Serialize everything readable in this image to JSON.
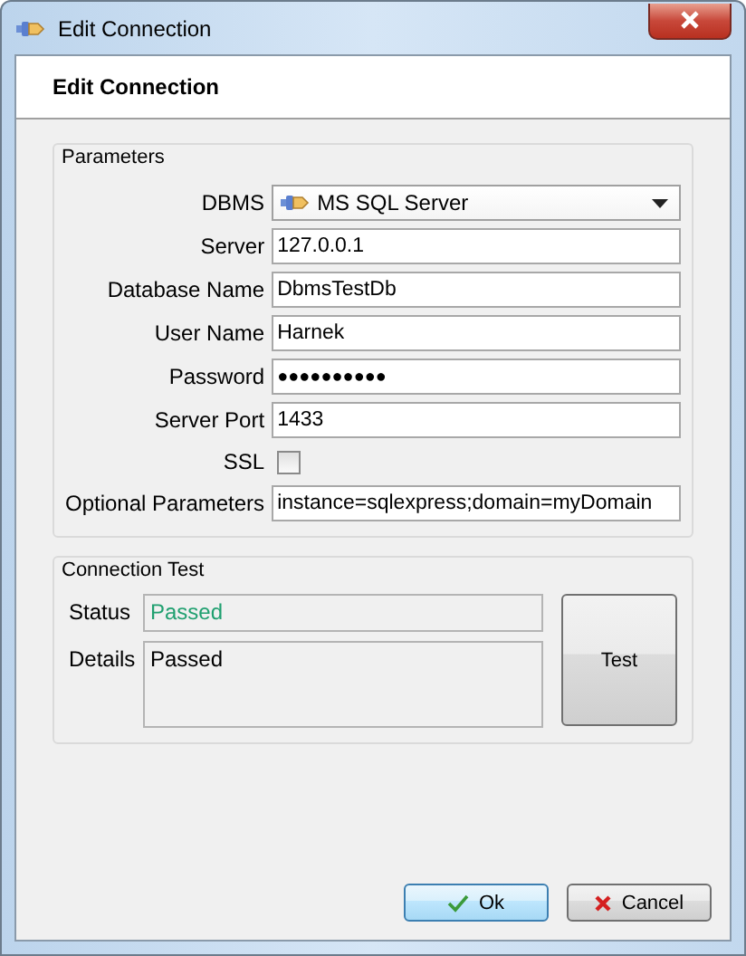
{
  "window": {
    "title": "Edit Connection"
  },
  "header": {
    "title": "Edit Connection"
  },
  "parameters": {
    "title": "Parameters",
    "fields": [
      {
        "kind": "dropdown",
        "label": "DBMS",
        "value": "MS SQL Server"
      },
      {
        "kind": "text",
        "label": "Server",
        "value": "127.0.0.1"
      },
      {
        "kind": "text",
        "label": "Database Name",
        "value": "DbmsTestDb"
      },
      {
        "kind": "text",
        "label": "User Name",
        "value": "Harnek"
      },
      {
        "kind": "password",
        "label": "Password",
        "value": "●●●●●●●●●●"
      },
      {
        "kind": "text",
        "label": "Server Port",
        "value": "1433"
      },
      {
        "kind": "checkbox",
        "label": "SSL",
        "checked": false
      },
      {
        "kind": "text",
        "label": "Optional Parameters",
        "value": "instance=sqlexpress;domain=myDomain"
      }
    ]
  },
  "connection_test": {
    "title": "Connection Test",
    "status_label": "Status",
    "status": "Passed",
    "details_label": "Details",
    "details": "Passed",
    "test_button": "Test"
  },
  "buttons": [
    {
      "kind": "ok",
      "label": "Ok",
      "default": true
    },
    {
      "kind": "cancel",
      "label": "Cancel",
      "default": false
    }
  ]
}
